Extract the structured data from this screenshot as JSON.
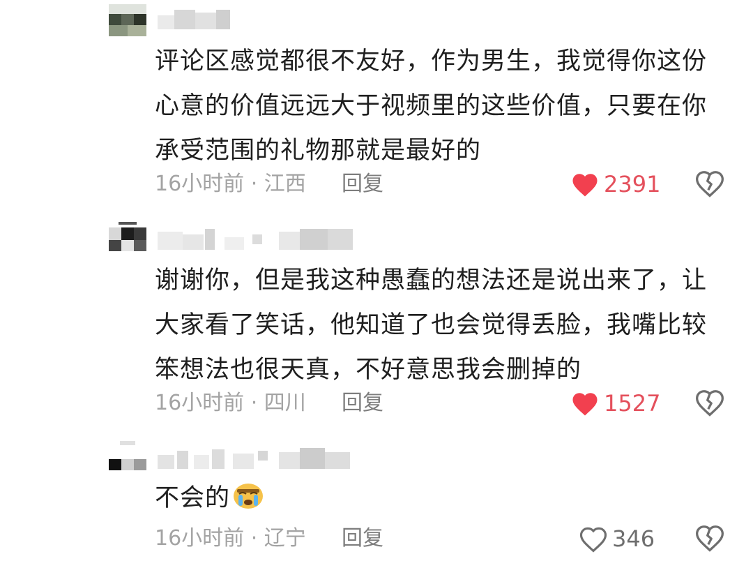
{
  "comments": [
    {
      "text_lines": [
        "评论区感觉都很不友好，作为男生，我觉得你这份",
        "心意的价值远远大于视频里的这些价值，只要在你",
        "承受范围的礼物那就是最好的"
      ],
      "time": "16小时前",
      "location": "江西",
      "reply_label": "回复",
      "likes": "2391",
      "liked": true
    },
    {
      "text_lines": [
        "谢谢你，但是我这种愚蠢的想法还是说出来了，让",
        "大家看了笑话，他知道了也会觉得丢脸，我嘴比较",
        "笨想法也很天真，不好意思我会删掉的"
      ],
      "time": "16小时前",
      "location": "四川",
      "reply_label": "回复",
      "likes": "1527",
      "liked": true
    },
    {
      "text_lines": [
        "不会的"
      ],
      "emoji": "crying-face",
      "time": "16小时前",
      "location": "辽宁",
      "reply_label": "回复",
      "likes": "346",
      "liked": false
    }
  ],
  "colors": {
    "liked_heart": "#f2404f",
    "liked_count": "#e4505c",
    "unliked": "#6e6e6e",
    "meta_text": "#a3a3a3",
    "reply_text": "#7d7d7d",
    "body_text": "#1f1f1f"
  },
  "separator": " · "
}
